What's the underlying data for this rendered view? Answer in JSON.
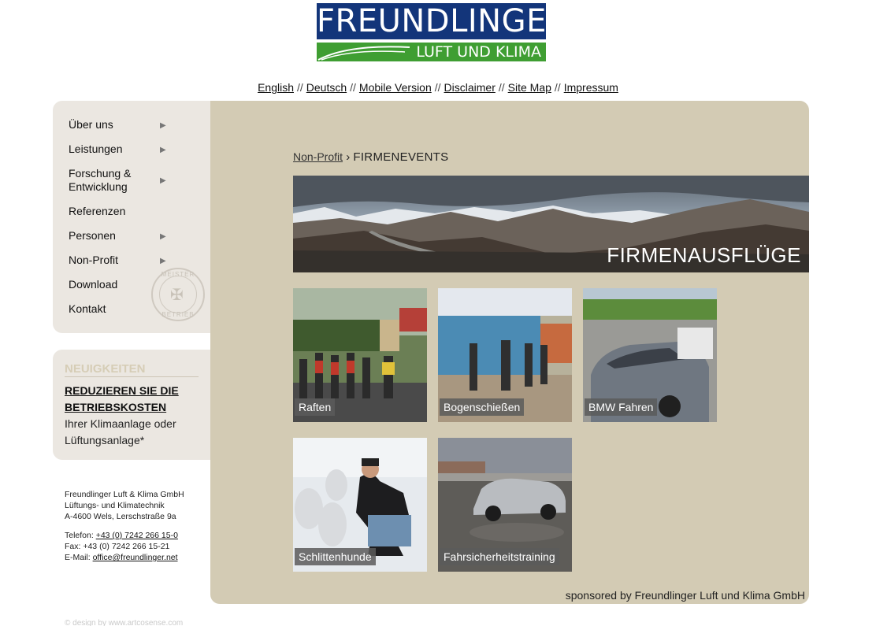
{
  "logo": {
    "top": "FREUNDLINGER",
    "bottom": "LUFT UND KLIMA"
  },
  "toplinks": [
    "English",
    "Deutsch",
    "Mobile Version",
    "Disclaimer",
    "Site Map",
    "Impressum"
  ],
  "toplinks_separator": "//",
  "nav": [
    {
      "label": "Über uns",
      "arrow": true
    },
    {
      "label": "Leistungen",
      "arrow": true
    },
    {
      "label": "Forschung & Entwicklung",
      "arrow": true
    },
    {
      "label": "Referenzen",
      "arrow": false
    },
    {
      "label": "Personen",
      "arrow": true
    },
    {
      "label": "Non-Profit",
      "arrow": true
    },
    {
      "label": "Download",
      "arrow": false
    },
    {
      "label": "Kontakt",
      "arrow": false
    }
  ],
  "seal": {
    "top": "MEISTER",
    "bottom": "BETRIEB"
  },
  "news": {
    "heading": "NEUIGKEITEN",
    "title": "REDUZIEREN SIE DIE BETRIEBSKOSTEN",
    "text": "Ihrer Klimaanlage oder Lüftungsanlage*"
  },
  "address": {
    "company": "Freundlinger Luft & Klima GmbH",
    "tagline": "Lüftungs- und Klimatechnik",
    "street": "A-4600 Wels, Lerschstraße 9a",
    "phone_label": "Telefon:",
    "phone": "+43 (0) 7242 266 15-0",
    "fax": "Fax: +43 (0) 7242 266 15-21",
    "email_label": "E-Mail:",
    "email": "office@freundlinger.net"
  },
  "footer_credit": "© design by www.artcosense.com",
  "breadcrumb": {
    "parent": "Non-Profit",
    "separator": "›",
    "current": "FIRMENEVENTS"
  },
  "banner_title": "FIRMENAUSFLÜGE",
  "tiles": [
    "Raften",
    "Bogenschießen",
    "BMW Fahren",
    "Schlittenhunde",
    "Fahrsicherheitstraining"
  ],
  "sponsor": "sponsored by Freundlinger Luft und Klima GmbH",
  "colors": {
    "panel": "#d3cbb4",
    "sidebar": "#ebe7e1",
    "logo_blue": "#13357a",
    "logo_green": "#3f9e32"
  }
}
